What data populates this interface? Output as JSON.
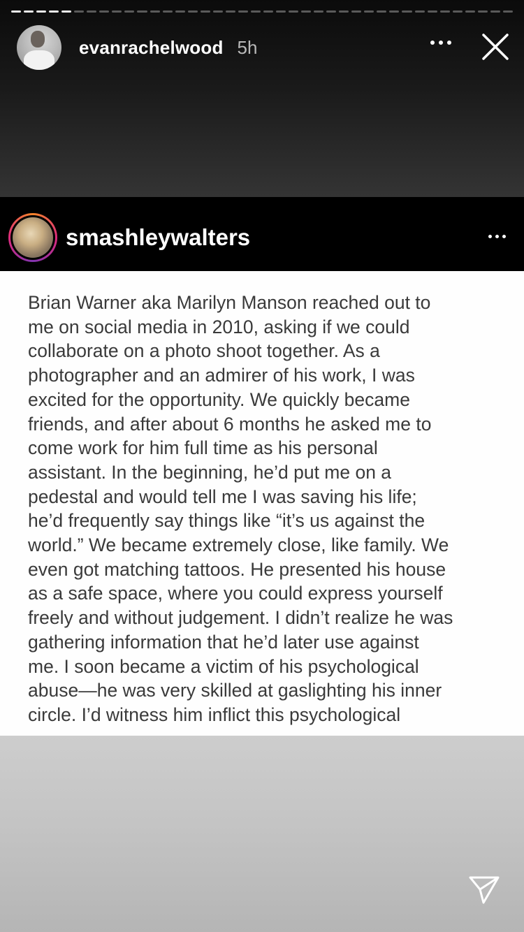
{
  "story": {
    "progress_total": 40,
    "progress_seen": 5,
    "username": "evanrachelwood",
    "time": "5h"
  },
  "post": {
    "username": "smashleywalters",
    "lines": [
      "Brian Warner aka Marilyn Manson reached out to",
      "me on social media in 2010, asking if we could",
      "collaborate on a photo shoot together. As a",
      "photographer and an admirer of his work, I was",
      "excited for the opportunity. We quickly became",
      "friends, and after about 6 months he asked me to",
      "come work for him full time as his personal",
      "assistant. In the beginning, he’d put me on a",
      "pedestal and would tell me I was saving his life;",
      "he’d frequently say things like “it’s us against the",
      "world.” We became extremely close, like family. We",
      "even got matching tattoos. He presented his house",
      "as a safe space, where you could express yourself",
      "freely and without judgement. I didn’t realize he was",
      "gathering information that he’d later use against",
      "me. I soon became a victim of his psychological",
      "abuse—he was very skilled at gaslighting his inner",
      "circle. I’d witness him inflict this psychological"
    ]
  },
  "icons": {
    "more": "more-dots-icon",
    "close": "close-icon",
    "send": "send-icon"
  }
}
